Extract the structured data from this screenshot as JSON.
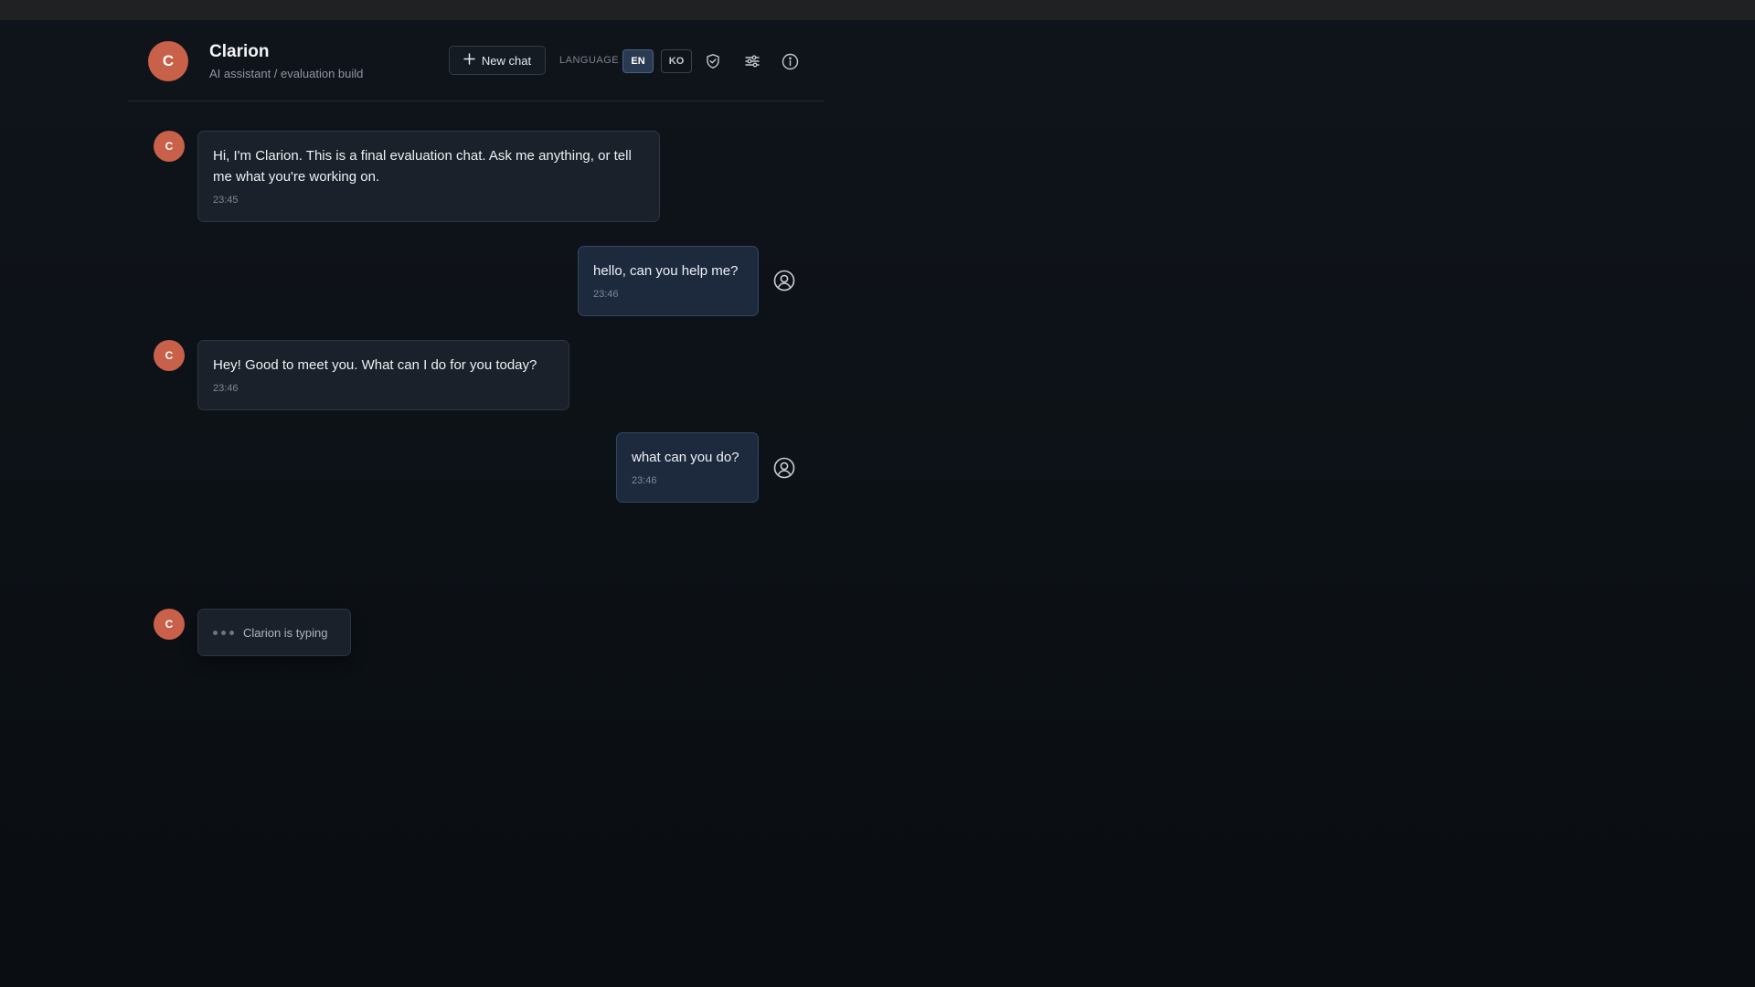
{
  "header": {
    "avatar_letter": "C",
    "title": "Clarion",
    "subtitle": "AI assistant / evaluation build",
    "new_chat_label": "New chat",
    "language_label": "LANGUAGE",
    "languages": [
      {
        "code": "EN",
        "active": true
      },
      {
        "code": "KO",
        "active": false
      }
    ],
    "icons": [
      "shield-check-icon",
      "sliders-icon",
      "info-icon"
    ]
  },
  "messages": [
    {
      "role": "assistant",
      "avatar": "C",
      "text": "Hi, I'm Clarion. This is a final evaluation chat. Ask me anything, or tell me what you're working on.",
      "time": "23:45"
    },
    {
      "role": "user",
      "text": "hello, can you help me?",
      "time": "23:46"
    },
    {
      "role": "assistant",
      "avatar": "C",
      "text": "Hey! Good to meet you. What can I do for you today?",
      "time": "23:46"
    },
    {
      "role": "user",
      "text": "what can you do?",
      "time": "23:46"
    }
  ],
  "typing": {
    "avatar": "C",
    "label": "Clarion is typing"
  },
  "colors": {
    "accent_avatar": "#c8604a",
    "background": "#0c1116",
    "bot_bubble": "#1a212a",
    "user_bubble": "#1d2a3e"
  }
}
